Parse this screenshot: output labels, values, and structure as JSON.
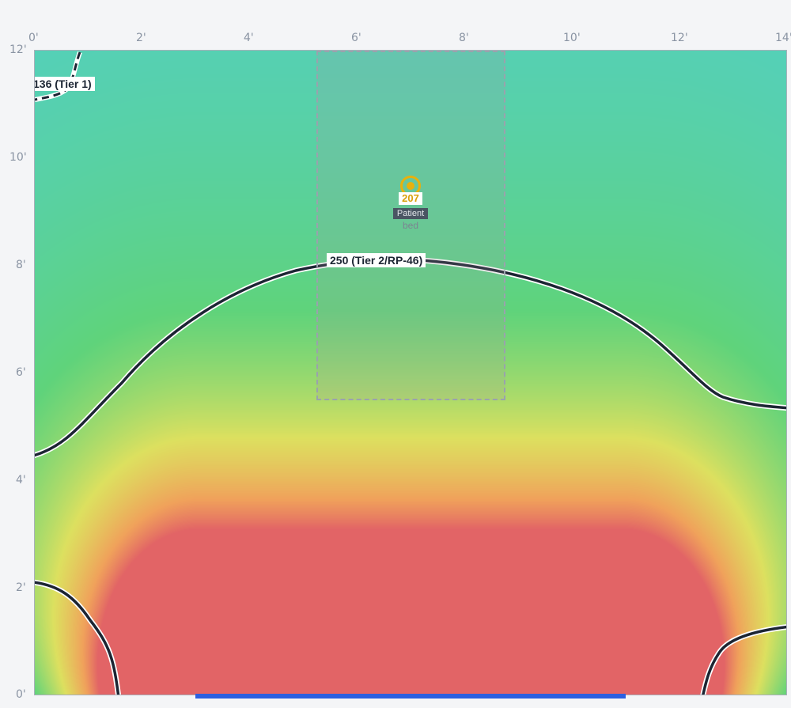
{
  "x_axis_ticks": [
    "0'",
    "2'",
    "4'",
    "6'",
    "8'",
    "10'",
    "12'",
    "14'"
  ],
  "y_axis_ticks": [
    "12'",
    "10'",
    "8'",
    "6'",
    "4'",
    "2'",
    "0'"
  ],
  "contours": {
    "tier1_label": "136 (Tier 1)",
    "tier2_label": "250 (Tier 2/RP-46)"
  },
  "sensor": {
    "value": "207",
    "tag": "Patient",
    "caption": "bed"
  },
  "colors": {
    "low": "#5aa8d8",
    "mid_low": "#52cfc9",
    "mid": "#5fd37b",
    "high": "#dde05f",
    "warm": "#f0a25b",
    "peak": "#e26466",
    "sensor": "#e8b10d",
    "source_bar": "#2c5fe0",
    "contour": "#1c2533"
  },
  "chart_data": {
    "type": "heatmap",
    "xlabel": "",
    "ylabel": "",
    "xlim": [
      0,
      14
    ],
    "ylim": [
      0,
      12
    ],
    "x_ticks": [
      0,
      2,
      4,
      6,
      8,
      10,
      12,
      14
    ],
    "y_ticks": [
      0,
      2,
      4,
      6,
      8,
      10,
      12
    ],
    "contours": [
      {
        "level": 136,
        "label": "136 (Tier 1)"
      },
      {
        "level": 250,
        "label": "250 (Tier 2/RP-46)"
      }
    ],
    "sensor": {
      "x": 7.0,
      "y": 9.6,
      "value": 207,
      "label": "Patient bed"
    },
    "bed_zone": {
      "x_range": [
        5.25,
        8.75
      ],
      "y_range": [
        5.5,
        12
      ]
    },
    "source": {
      "x_range": [
        3,
        11
      ],
      "y": 0
    }
  }
}
